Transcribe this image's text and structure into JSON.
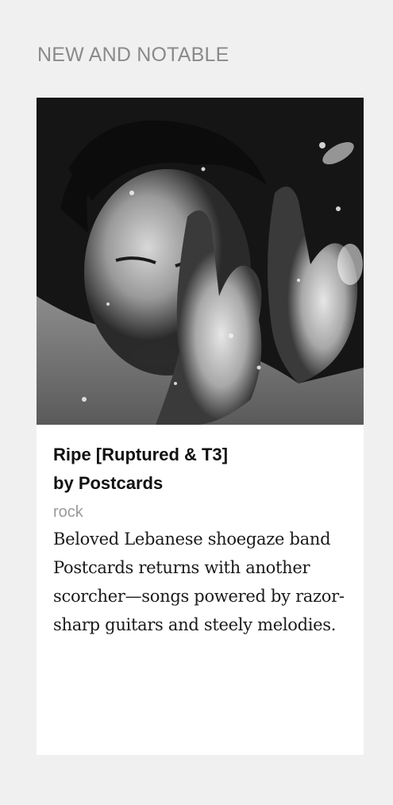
{
  "section": {
    "title": "NEW AND NOTABLE"
  },
  "feature": {
    "cover_icon": "album-cover-photo",
    "album": "Ripe [Ruptured & T3]",
    "by_prefix": "by",
    "artist": "Postcards",
    "genre": "rock",
    "description": "Beloved Lebanese shoegaze band Postcards returns with another scorcher—songs powered by razor-sharp guitars and steely melodies."
  }
}
